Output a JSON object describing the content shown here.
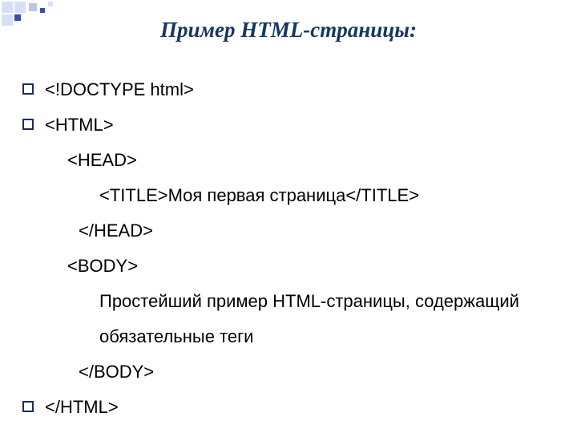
{
  "title": "Пример   HTML-страницы:",
  "code": {
    "l1": "<!DOCTYPE html>",
    "l2": "<HTML>",
    "l3": "<HEAD>",
    "l4": "<TITLE>Моя первая страница</TITLE>",
    "l5": "</HEAD>",
    "l6": "<BODY>",
    "l7a": "Простейший пример HTML-страницы, содержащий",
    "l7b": "обязательные теги",
    "l8": "</BODY>",
    "l9": "</HTML>"
  }
}
